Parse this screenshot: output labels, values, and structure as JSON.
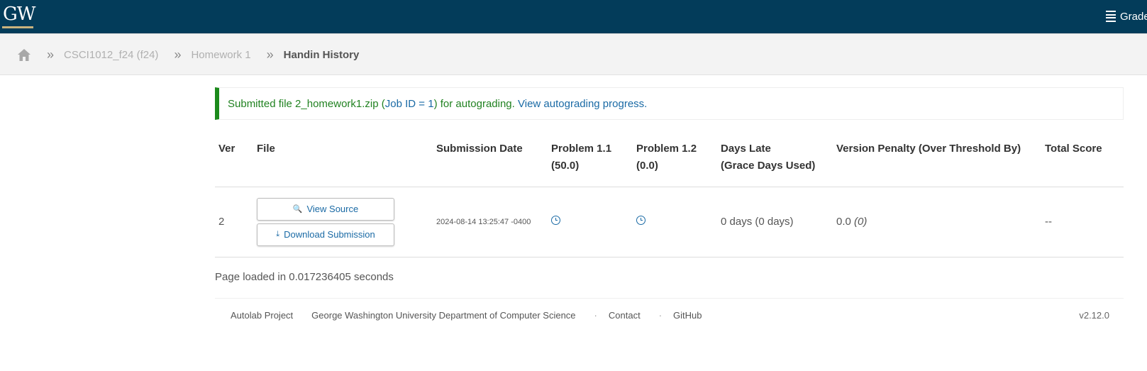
{
  "header": {
    "logo_text": "GW",
    "gradebook_label": "Grade",
    "brand_color": "#033c5a",
    "accent_color": "#c9b37e"
  },
  "breadcrumb": {
    "home_icon": "home-icon",
    "separator": "»",
    "items": [
      "CSCI1012_f24 (f24)",
      "Homework 1"
    ],
    "current": "Handin History"
  },
  "alert": {
    "prefix": "Submitted file 2_homework1.zip (",
    "job_link": "Job ID = 1",
    "middle": ") for autograding.",
    "progress_link": "View autograding progress."
  },
  "table": {
    "headers": {
      "ver": "Ver",
      "file": "File",
      "date": "Submission Date",
      "p1_title": "Problem 1.1",
      "p1_points": "(50.0)",
      "p2_title": "Problem 1.2",
      "p2_points": "(0.0)",
      "late_title": "Days Late",
      "late_sub": "(Grace Days Used)",
      "penalty": "Version Penalty (Over Threshold By)",
      "total": "Total Score"
    },
    "rows": [
      {
        "ver": "2",
        "view_source": "View Source",
        "download": "Download Submission",
        "date": "2024-08-14 13:25:47 -0400",
        "p1_status_icon": "clock-icon",
        "p2_status_icon": "clock-icon",
        "days_late": "0 days (0 days)",
        "penalty_value": "0.0",
        "penalty_over": "(0)",
        "total": "--"
      }
    ]
  },
  "page_load": "Page loaded in 0.017236405 seconds",
  "footer": {
    "project": "Autolab Project",
    "department": "George Washington University Department of Computer Science",
    "separator": "·",
    "contact": "Contact",
    "github": "GitHub",
    "version": "v2.12.0"
  }
}
